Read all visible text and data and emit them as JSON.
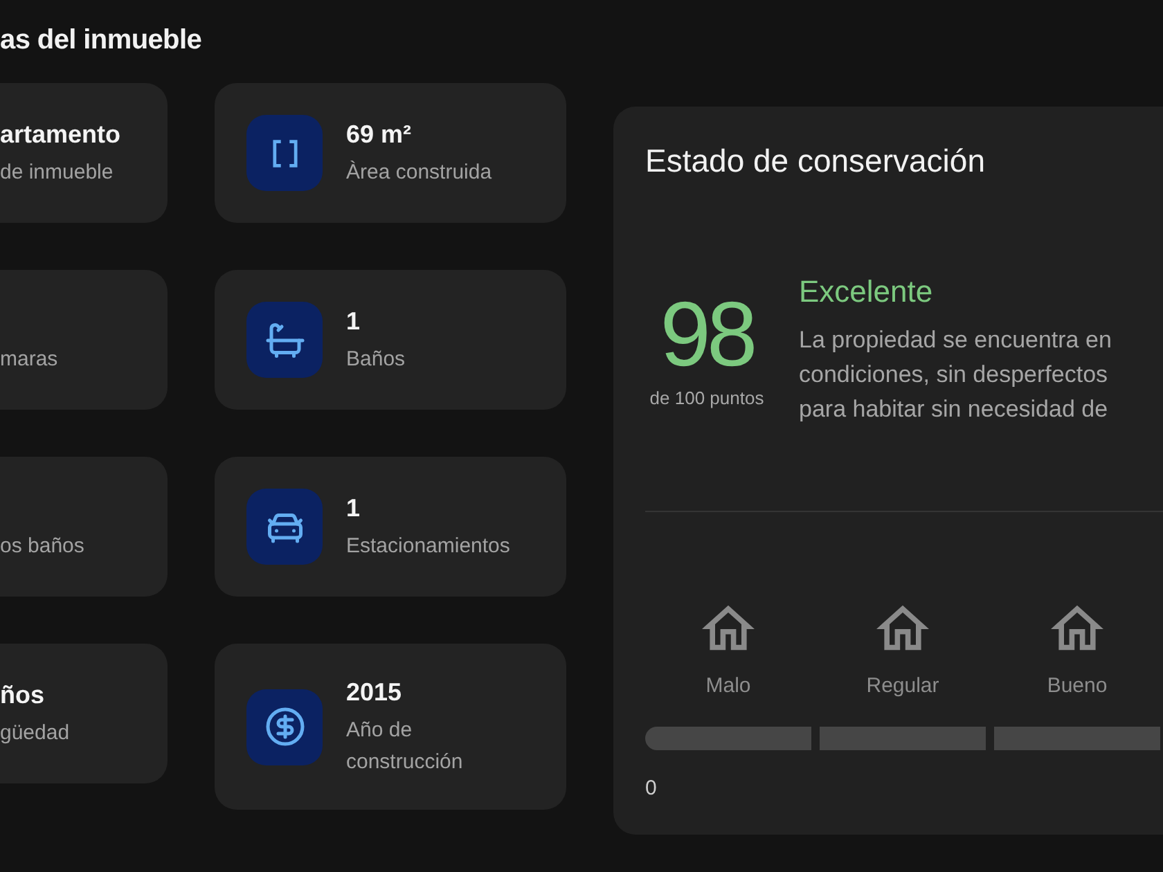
{
  "section_title": "as del inmueble",
  "cards_column_1": [
    {
      "value": "artamento",
      "label": "de inmueble"
    },
    {
      "label": "maras"
    },
    {
      "label": "os baños"
    },
    {
      "value": "ños",
      "label": "güedad"
    }
  ],
  "cards_column_2": [
    {
      "kind": "area",
      "value": "69 m²",
      "label": "Àrea construida"
    },
    {
      "kind": "bath",
      "value": "1",
      "label": "Baños"
    },
    {
      "kind": "parking",
      "value": "1",
      "label": "Estacionamientos"
    },
    {
      "kind": "year",
      "value": "2015",
      "label": "Año de construcción"
    }
  ],
  "conservation": {
    "title": "Estado de conservación",
    "score": "98",
    "score_caption": "de 100 puntos",
    "rating": "Excelente",
    "description_lines": [
      "La propiedad se encuentra en",
      "condiciones, sin desperfectos",
      "para habitar sin necesidad de"
    ],
    "scale": [
      {
        "label": "Malo"
      },
      {
        "label": "Regular"
      },
      {
        "label": "Bueno"
      }
    ],
    "scale_start": "0"
  }
}
